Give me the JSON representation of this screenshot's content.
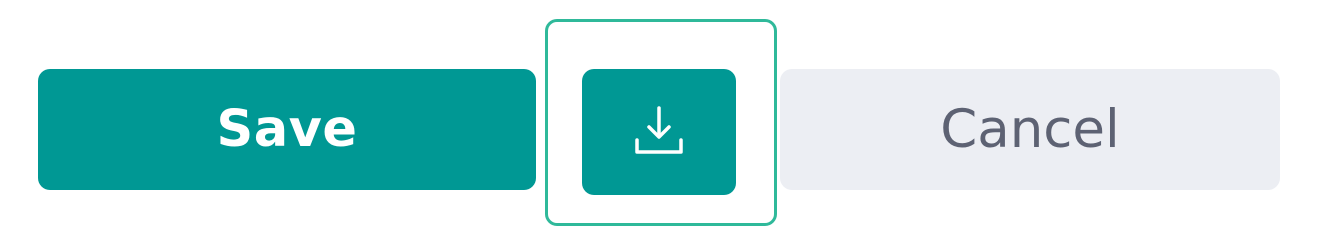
{
  "actions": {
    "save_label": "Save",
    "download_icon": "download-icon",
    "cancel_label": "Cancel"
  },
  "colors": {
    "primary": "#009894",
    "focus_ring": "#2fb99a",
    "secondary_bg": "#eceef3",
    "secondary_text": "#5d6273"
  }
}
